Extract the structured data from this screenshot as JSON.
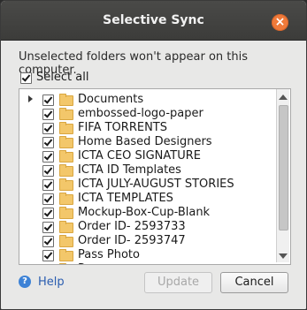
{
  "dialog": {
    "title": "Selective Sync",
    "close_glyph": "×",
    "message": "Unselected folders won't appear on this computer.",
    "select_all_label": "Select all",
    "select_all_checked": true
  },
  "folders": [
    {
      "label": "Documents",
      "checked": true,
      "expandable": true
    },
    {
      "label": "embossed-logo-paper",
      "checked": true
    },
    {
      "label": "FIFA TORRENTS",
      "checked": true
    },
    {
      "label": "Home Based Designers",
      "checked": true
    },
    {
      "label": "ICTA CEO SIGNATURE",
      "checked": true
    },
    {
      "label": "ICTA ID Templates",
      "checked": true
    },
    {
      "label": "ICTA JULY-AUGUST STORIES",
      "checked": true
    },
    {
      "label": "ICTA TEMPLATES",
      "checked": true
    },
    {
      "label": "Mockup-Box-Cup-Blank",
      "checked": true
    },
    {
      "label": "Order ID- 2593733",
      "checked": true
    },
    {
      "label": "Order ID- 2593747",
      "checked": true
    },
    {
      "label": "Pass Photo",
      "checked": true
    },
    {
      "label": "P...",
      "checked": true
    }
  ],
  "footer": {
    "help_label": "Help",
    "help_icon": "question-icon",
    "update_label": "Update",
    "update_enabled": false,
    "cancel_label": "Cancel"
  },
  "colors": {
    "titlebar": "#3c3c3a",
    "close_button": "#ef7a3a",
    "folder": "#f3c76a",
    "help_link": "#2a5db0"
  }
}
